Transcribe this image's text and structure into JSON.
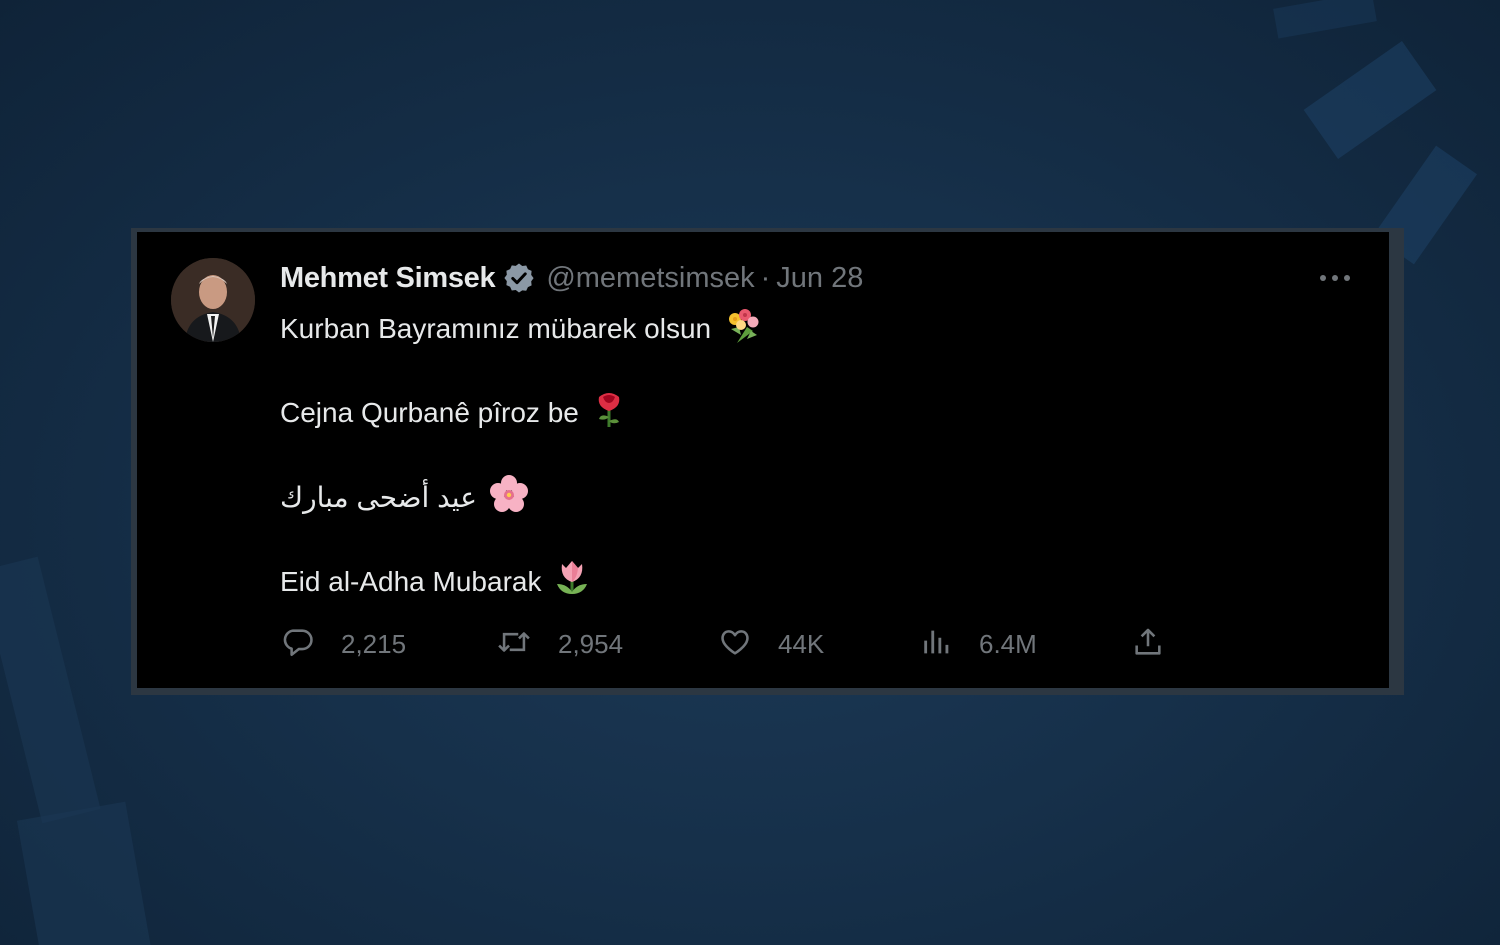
{
  "tweet": {
    "author_name": "Mehmet Simsek",
    "handle": "@memetsimsek",
    "separator": "·",
    "date": "Jun 28",
    "lines": [
      "Kurban Bayramınız mübarek olsun",
      "Cejna Qurbanê pîroz be",
      "عيد أضحى مبارك",
      "Eid al-Adha Mubarak"
    ],
    "line_emojis": [
      "bouquet-emoji",
      "rose-emoji",
      "cherry-blossom-emoji",
      "tulip-emoji"
    ],
    "stats": {
      "replies": "2,215",
      "reposts": "2,954",
      "likes": "44K",
      "views": "6.4M"
    }
  },
  "icons": {
    "verified": "verified-badge-icon",
    "more": "more-options-icon",
    "reply": "reply-icon",
    "repost": "repost-icon",
    "like": "heart-icon",
    "views": "views-icon",
    "share": "share-icon"
  },
  "colors": {
    "card_background": "#000000",
    "primary_text": "#e7e9ea",
    "secondary_text": "#71767b",
    "verified_badge": "#8b98a5",
    "page_background": "#16304a"
  }
}
